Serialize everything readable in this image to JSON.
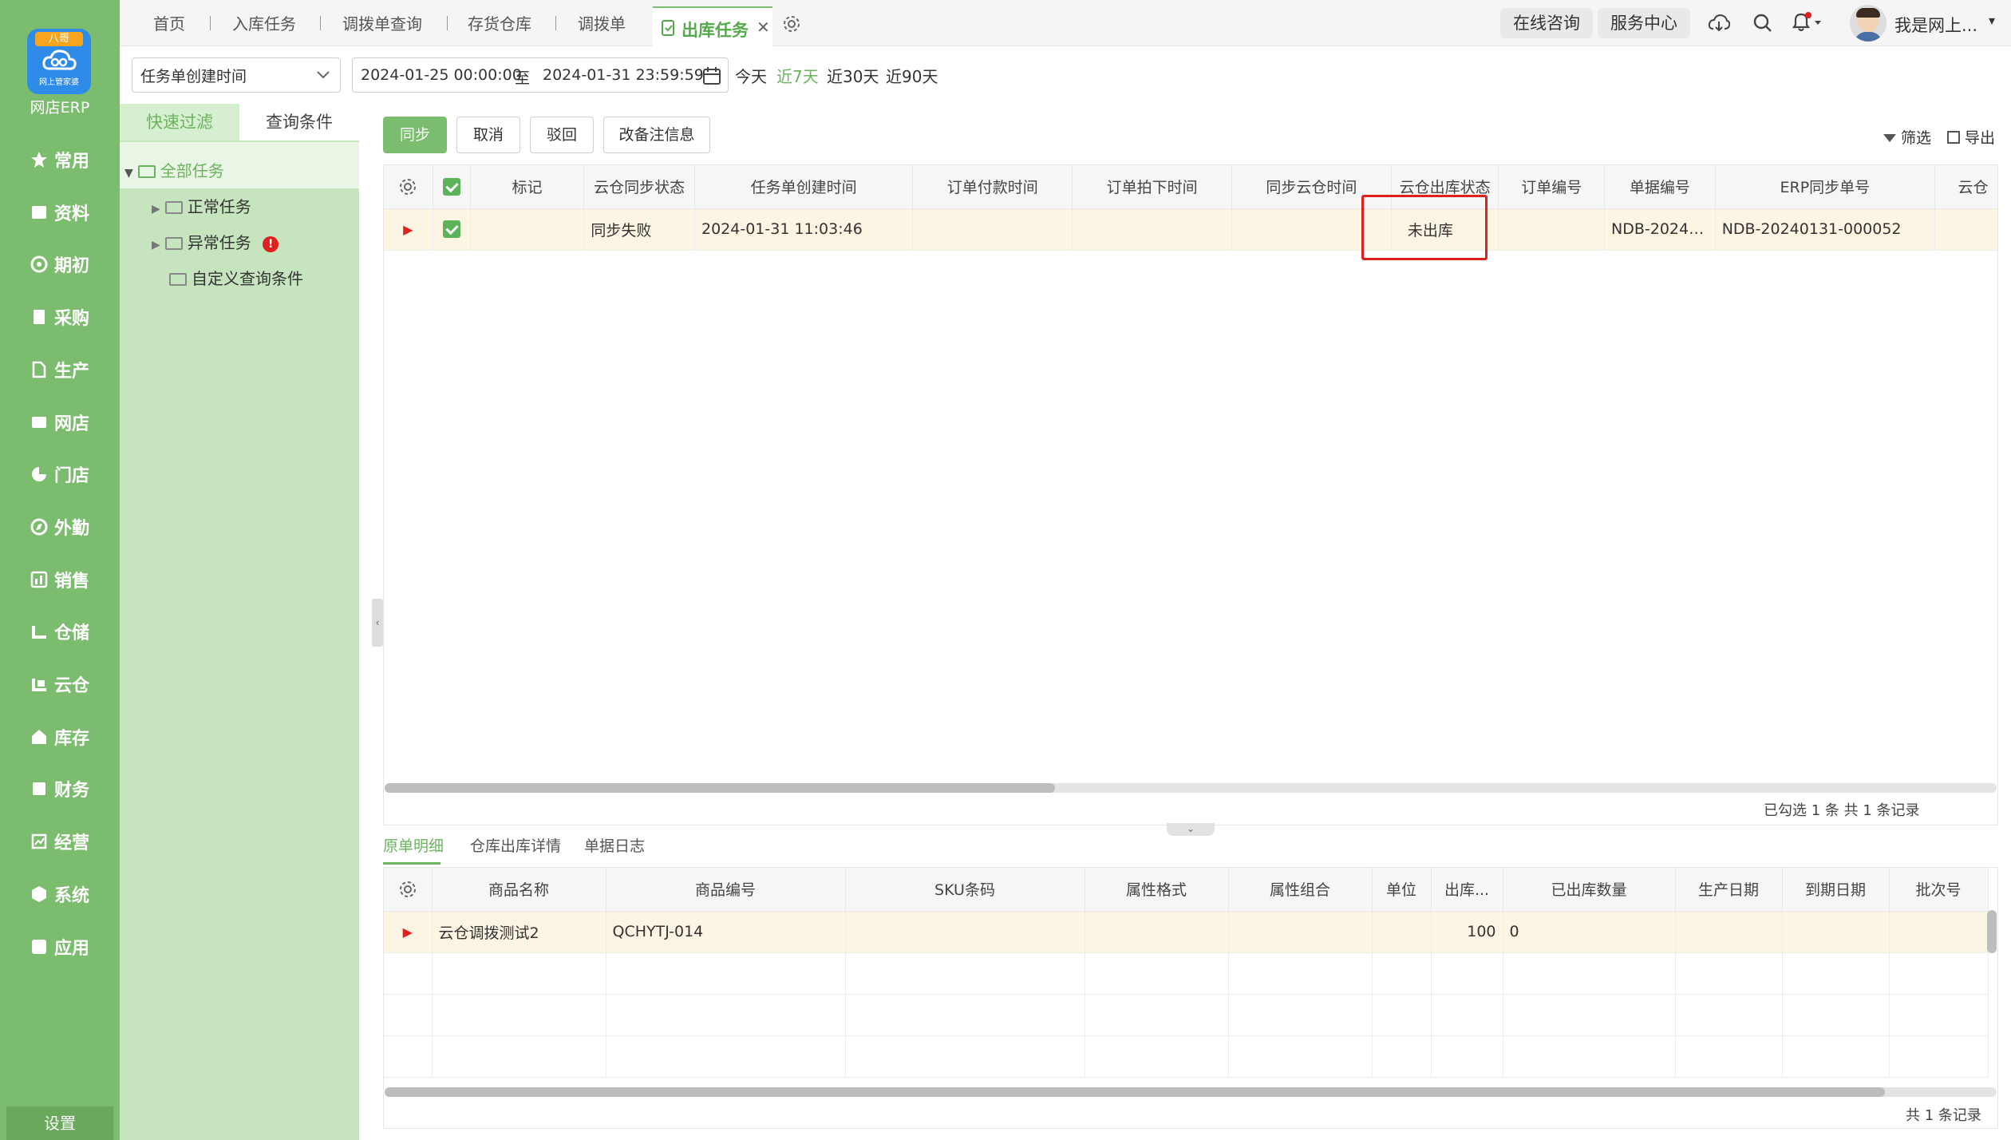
{
  "app": {
    "logo_badge": "八哥",
    "logo_sub": "网上管家婆",
    "name": "网店ERP",
    "nav": [
      {
        "label": "常用",
        "icon": "star-icon"
      },
      {
        "label": "资料",
        "icon": "profile-icon"
      },
      {
        "label": "期初",
        "icon": "target-icon"
      },
      {
        "label": "采购",
        "icon": "document-icon"
      },
      {
        "label": "生产",
        "icon": "file-icon"
      },
      {
        "label": "网店",
        "icon": "store-icon"
      },
      {
        "label": "门店",
        "icon": "pie-icon"
      },
      {
        "label": "外勤",
        "icon": "compass-icon"
      },
      {
        "label": "销售",
        "icon": "bar-icon"
      },
      {
        "label": "仓储",
        "icon": "warehouse-icon"
      },
      {
        "label": "云仓",
        "icon": "cloud-warehouse-icon"
      },
      {
        "label": "库存",
        "icon": "home-icon"
      },
      {
        "label": "财务",
        "icon": "ledger-icon"
      },
      {
        "label": "经营",
        "icon": "chart-icon"
      },
      {
        "label": "系统",
        "icon": "hexagon-icon"
      },
      {
        "label": "应用",
        "icon": "plus-icon"
      }
    ],
    "settings": "设置"
  },
  "tabs": {
    "items": [
      "首页",
      "入库任务",
      "调拨单查询",
      "存货仓库",
      "调拨单"
    ],
    "active": "出库任务"
  },
  "topbar": {
    "consult": "在线咨询",
    "service": "服务中心",
    "user": "我是网上..."
  },
  "filter": {
    "field": "任务单创建时间",
    "start": "2024-01-25 00:00:00",
    "to": "至",
    "end": "2024-01-31 23:59:59",
    "quick": [
      "今天",
      "近7天",
      "近30天",
      "近90天"
    ]
  },
  "panel": {
    "tab_quick": "快速过滤",
    "tab_query": "查询条件",
    "tree": {
      "root": "全部任务",
      "normal": "正常任务",
      "abnormal": "异常任务",
      "custom": "自定义查询条件"
    }
  },
  "toolbar": {
    "sync": "同步",
    "cancel": "取消",
    "reject": "驳回",
    "edit_note": "改备注信息",
    "filter": "筛选",
    "export": "导出"
  },
  "main_table": {
    "headers": [
      "标记",
      "云仓同步状态",
      "任务单创建时间",
      "订单付款时间",
      "订单拍下时间",
      "同步云仓时间",
      "云仓出库状态",
      "订单编号",
      "单据编号",
      "ERP同步单号",
      "云仓"
    ],
    "row": {
      "mark": "",
      "sync_status": "同步失败",
      "created": "2024-01-31 11:03:46",
      "paid": "",
      "ordered": "",
      "synced": "",
      "outbound_status": "未出库",
      "order_no": "",
      "doc_no": "NDB-20240...",
      "erp_no": "NDB-20240131-000052",
      "cloud": ""
    },
    "footer": "已勾选 1 条  共 1 条记录"
  },
  "detail": {
    "tabs": [
      "原单明细",
      "仓库出库详情",
      "单据日志"
    ],
    "headers": [
      "商品名称",
      "商品编号",
      "SKU条码",
      "属性格式",
      "属性组合",
      "单位",
      "出库...",
      "已出库数量",
      "生产日期",
      "到期日期",
      "批次号"
    ],
    "row": {
      "name": "云仓调拨测试2",
      "code": "QCHYTJ-014",
      "sku": "",
      "attr_format": "",
      "attr_combo": "",
      "unit": "",
      "out_qty": "100",
      "done_qty": "0",
      "prod_date": "",
      "exp_date": "",
      "batch": ""
    },
    "footer": "共 1 条记录"
  },
  "colors": {
    "brand_green": "#7cbc6e",
    "panel_green": "#c6e5bf",
    "highlight_red": "#e0201c",
    "selected_row": "#fdf5e3"
  }
}
